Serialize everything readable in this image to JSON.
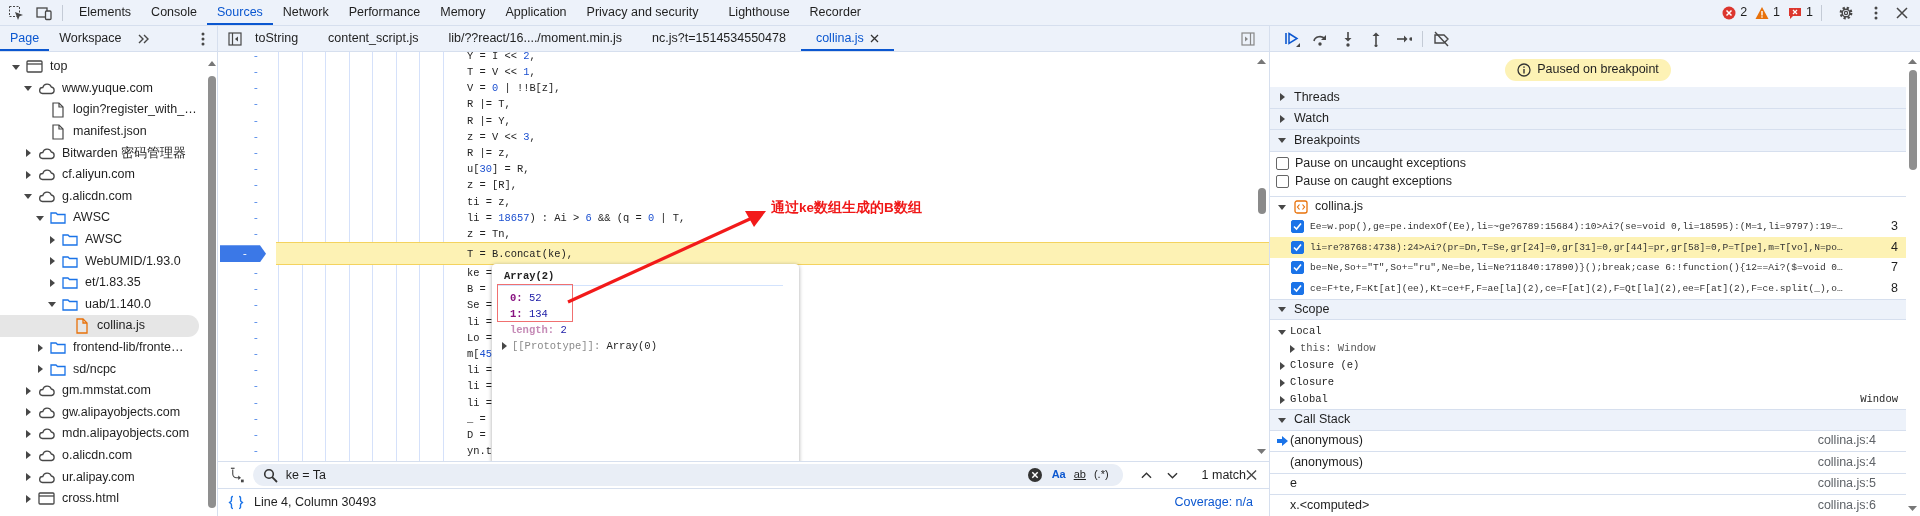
{
  "devtools_tabs": [
    {
      "label": "Elements",
      "selected": false
    },
    {
      "label": "Console",
      "selected": false
    },
    {
      "label": "Sources",
      "selected": true
    },
    {
      "label": "Network",
      "selected": false
    },
    {
      "label": "Performance",
      "selected": false
    },
    {
      "label": "Memory",
      "selected": false
    },
    {
      "label": "Application",
      "selected": false
    },
    {
      "label": "Privacy and security",
      "selected": false
    },
    {
      "label": "Lighthouse",
      "selected": false
    },
    {
      "label": "Recorder",
      "selected": false
    }
  ],
  "issue_counts": {
    "errors": "2",
    "warnings": "1",
    "messages": "1"
  },
  "sidebar": {
    "tabs": [
      {
        "label": "Page",
        "selected": true
      },
      {
        "label": "Workspace",
        "selected": false
      }
    ],
    "tree": [
      {
        "label": "top",
        "kind": "frame",
        "expanded": true,
        "selected": false,
        "children": [
          {
            "label": "www.yuque.com",
            "kind": "domain",
            "expanded": true,
            "selected": false,
            "children": [
              {
                "label": "login?register_with_…",
                "kind": "file",
                "selected": false
              },
              {
                "label": "manifest.json",
                "kind": "file",
                "selected": false
              }
            ]
          },
          {
            "label": "Bitwarden 密码管理器",
            "kind": "domain",
            "expanded": false,
            "selected": false
          },
          {
            "label": "cf.aliyun.com",
            "kind": "domain",
            "expanded": false,
            "selected": false
          },
          {
            "label": "g.alicdn.com",
            "kind": "domain",
            "expanded": true,
            "selected": false,
            "children": [
              {
                "label": "AWSC",
                "kind": "folder",
                "expanded": true,
                "selected": false,
                "children": [
                  {
                    "label": "AWSC",
                    "kind": "folder",
                    "expanded": false,
                    "selected": false
                  },
                  {
                    "label": "WebUMID/1.93.0",
                    "kind": "folder",
                    "expanded": false,
                    "selected": false
                  },
                  {
                    "label": "et/1.83.35",
                    "kind": "folder",
                    "expanded": false,
                    "selected": false
                  },
                  {
                    "label": "uab/1.140.0",
                    "kind": "folder",
                    "expanded": true,
                    "selected": false,
                    "children": [
                      {
                        "label": "collina.js",
                        "kind": "script",
                        "selected": true
                      }
                    ]
                  }
                ]
              },
              {
                "label": "frontend-lib/fronte…",
                "kind": "folder",
                "expanded": false,
                "selected": false
              },
              {
                "label": "sd/ncpc",
                "kind": "folder",
                "expanded": false,
                "selected": false
              }
            ]
          },
          {
            "label": "gm.mmstat.com",
            "kind": "domain",
            "expanded": false,
            "selected": false
          },
          {
            "label": "gw.alipayobjects.com",
            "kind": "domain",
            "expanded": false,
            "selected": false
          },
          {
            "label": "mdn.alipayobjects.com",
            "kind": "domain",
            "expanded": false,
            "selected": false
          },
          {
            "label": "o.alicdn.com",
            "kind": "domain",
            "expanded": false,
            "selected": false
          },
          {
            "label": "ur.alipay.com",
            "kind": "domain",
            "expanded": false,
            "selected": false
          },
          {
            "label": "cross.html",
            "kind": "frame",
            "expanded": false,
            "selected": false
          }
        ]
      }
    ]
  },
  "editor": {
    "tabs": [
      {
        "label": "toString",
        "selected": false
      },
      {
        "label": "content_script.js",
        "selected": false
      },
      {
        "label": "lib/??react/16..../moment.min.js",
        "selected": false
      },
      {
        "label": "nc.js?t=1514534550478",
        "selected": false
      },
      {
        "label": "collina.js",
        "selected": true
      }
    ],
    "lines": [
      {
        "number": "-",
        "text": "Y = I << 2,",
        "breakpoint": false,
        "current": false
      },
      {
        "number": "-",
        "text": "T = V << 1,",
        "breakpoint": false,
        "current": false
      },
      {
        "number": "-",
        "text": "V = 0 | !!B[z],",
        "breakpoint": false,
        "current": false
      },
      {
        "number": "-",
        "text": "R |= T,",
        "breakpoint": false,
        "current": false
      },
      {
        "number": "-",
        "text": "R |= Y,",
        "breakpoint": false,
        "current": false
      },
      {
        "number": "-",
        "text": "z = V << 3,",
        "breakpoint": false,
        "current": false
      },
      {
        "number": "-",
        "text": "R |= z,",
        "breakpoint": false,
        "current": false
      },
      {
        "number": "-",
        "text": "u[30] = R,",
        "breakpoint": false,
        "current": false
      },
      {
        "number": "-",
        "text": "z = [R],",
        "breakpoint": false,
        "current": false
      },
      {
        "number": "-",
        "text": "ti = z,",
        "breakpoint": false,
        "current": false
      },
      {
        "number": "-",
        "text": "li = 18657) : Ai > 6 && (q = 0 | T,",
        "breakpoint": false,
        "current": false
      },
      {
        "number": "-",
        "text": "z = Tn,",
        "breakpoint": false,
        "current": false
      },
      {
        "number": "-",
        "text": "T = B.concat(ke),",
        "breakpoint": true,
        "current": true
      },
      {
        "number": "-",
        "text": "ke =",
        "breakpoint": false,
        "current": false
      },
      {
        "number": "-",
        "text": "B =",
        "breakpoint": false,
        "current": false
      },
      {
        "number": "-",
        "text": "Se =",
        "breakpoint": false,
        "current": false
      },
      {
        "number": "-",
        "text": "li =",
        "breakpoint": false,
        "current": false
      },
      {
        "number": "-",
        "text": "Lo =",
        "breakpoint": false,
        "current": false
      },
      {
        "number": "-",
        "text": "m[45",
        "breakpoint": false,
        "current": false
      },
      {
        "number": "-",
        "text": "li =",
        "breakpoint": false,
        "current": false
      },
      {
        "number": "-",
        "text": "li =",
        "breakpoint": false,
        "current": false
      },
      {
        "number": "-",
        "text": "li =",
        "breakpoint": false,
        "current": false
      },
      {
        "number": "-",
        "text": "_ =",
        "breakpoint": false,
        "current": false
      },
      {
        "number": "-",
        "text": "D =",
        "breakpoint": false,
        "current": false
      },
      {
        "number": "-",
        "text": "yn.t",
        "breakpoint": false,
        "current": false
      }
    ],
    "popover": {
      "title": "Array(2)",
      "entries": [
        {
          "key": "0:",
          "value": "52",
          "kind": "index"
        },
        {
          "key": "1:",
          "value": "134",
          "kind": "index"
        },
        {
          "key": "length:",
          "value": "2",
          "kind": "meta"
        },
        {
          "key": "[[Prototype]]:",
          "value": "Array(0)",
          "kind": "proto"
        }
      ]
    },
    "search": {
      "value": "ke = Ta",
      "options": [
        {
          "label": "Aa",
          "on": true
        },
        {
          "label": "ab",
          "on": false
        },
        {
          "label": "(.*)",
          "on": false
        }
      ],
      "result": "1 match"
    },
    "status": {
      "position": "Line 4, Column 30493",
      "coverage": "Coverage: n/a"
    }
  },
  "annotation": {
    "text": "通过ke数组生成的B数组"
  },
  "debugger": {
    "paused_message": "Paused on breakpoint",
    "sections": [
      {
        "title": "Threads",
        "kind": "plain",
        "expanded": false
      },
      {
        "title": "Watch",
        "kind": "plain",
        "expanded": false
      },
      {
        "title": "Breakpoints",
        "kind": "breakpoints",
        "expanded": true,
        "options": [
          {
            "label": "Pause on uncaught exceptions",
            "checked": false
          },
          {
            "label": "Pause on caught exceptions",
            "checked": false
          }
        ],
        "files": [
          {
            "name": "collina.js",
            "expanded": true,
            "breakpoints": [
              {
                "code": "Ee=w.pop(),ge=pe.indexOf(Ee),li=~ge?6789:15684):10>Ai?(se=void 0,li=18595):(M=1,li=9797):19=…",
                "line": "3",
                "checked": true,
                "selected": false
              },
              {
                "code": "li=re?8768:4738):24>Ai?(pr=Dn,T=Se,gr[24]=0,gr[31]=0,gr[44]=pr,gr[58]=0,P=T[pe],m=T[vo],N=po…",
                "line": "4",
                "checked": true,
                "selected": true
              },
              {
                "code": "be=Ne,So+=\"T\",So+=\"ru\",Ne=be,li=Ne?11840:17890)}();break;case 6:!function(){12==Ai?($=void 0…",
                "line": "7",
                "checked": true,
                "selected": false
              },
              {
                "code": "ce=F+te,F=Kt[at](ee),Kt=ce+F,F=ae[la](2),ce=F[at](2),F=Qt[la](2),ee=F[at](2),F=ce.split(_),o…",
                "line": "8",
                "checked": true,
                "selected": false
              }
            ]
          }
        ]
      },
      {
        "title": "Scope",
        "kind": "scope",
        "expanded": true,
        "items": [
          {
            "label": "Local",
            "expanded": true,
            "children": [
              {
                "label": "this: Window",
                "expanded": false
              }
            ]
          },
          {
            "label": "Closure (e)",
            "expanded": false
          },
          {
            "label": "Closure",
            "expanded": false
          },
          {
            "label": "Global",
            "expanded": false,
            "value": "Window"
          }
        ]
      },
      {
        "title": "Call Stack",
        "kind": "callstack",
        "expanded": true,
        "frames": [
          {
            "name": "(anonymous)",
            "location": "collina.js:4",
            "selected": true
          },
          {
            "name": "(anonymous)",
            "location": "collina.js:4",
            "selected": false
          },
          {
            "name": "e",
            "location": "collina.js:5",
            "selected": false
          },
          {
            "name": "x.<computed>",
            "location": "collina.js:6",
            "selected": false
          }
        ]
      }
    ]
  }
}
